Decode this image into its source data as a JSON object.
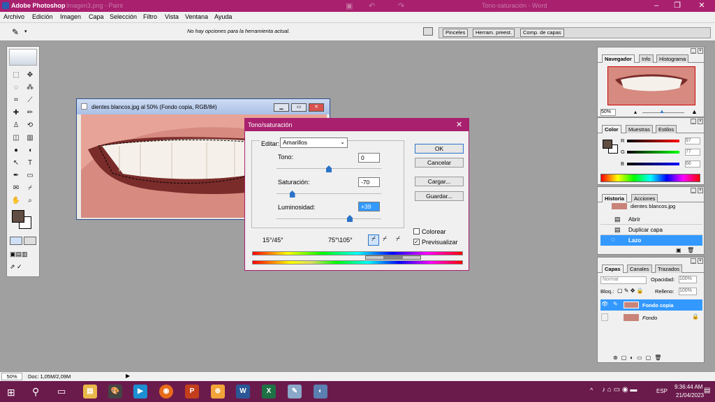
{
  "app": {
    "title": "Adobe Photoshop",
    "ghost_left": "Imagen3.png - Paint",
    "ghost_right": "Tono-saturación - Word"
  },
  "menu": [
    "Archivo",
    "Edición",
    "Imagen",
    "Capa",
    "Selección",
    "Filtro",
    "Vista",
    "Ventana",
    "Ayuda"
  ],
  "options": {
    "hint": "No hay opciones para la herramienta actual.",
    "tabs": [
      "Pinceles",
      "Herram. preest.",
      "Comp. de capas"
    ]
  },
  "document": {
    "title": "dientes blancos.jpg al 50% (Fondo copia, RGB/8#)"
  },
  "dialog": {
    "title": "Tono/saturación",
    "edit_label": "Editar:",
    "edit_value": "Amarillos",
    "tono_label": "Tono:",
    "tono_value": "0",
    "tono_level": 0.5,
    "sat_label": "Saturación:",
    "sat_value": "-70",
    "sat_level": 0.15,
    "lum_label": "Luminosidad:",
    "lum_value": "+39",
    "lum_level": 0.7,
    "range_left": "15°/45°",
    "range_right": "75°\\105°",
    "ok": "OK",
    "cancel": "Cancelar",
    "load": "Cargar...",
    "save": "Guardar...",
    "colorize": "Colorear",
    "preview": "Previsualizar",
    "preview_checked": true
  },
  "navigator": {
    "tabs": [
      "Navegador",
      "Info",
      "Histograma"
    ],
    "zoom": "50%"
  },
  "color": {
    "tabs": [
      "Color",
      "Muestras",
      "Estilos"
    ],
    "r_label": "R",
    "r": "97",
    "g_label": "G",
    "g": "77",
    "b_label": "B",
    "b": "66",
    "swatch": "#614d42"
  },
  "history": {
    "tabs": [
      "Historia",
      "Acciones"
    ],
    "snapshot": "dientes blancos.jpg",
    "items": [
      "Abrir",
      "Duplicar capa",
      "Lazo"
    ]
  },
  "layers": {
    "tabs": [
      "Capas",
      "Canales",
      "Trazados"
    ],
    "mode": "Normal",
    "opacity_label": "Opacidad:",
    "opacity": "100%",
    "lock_label": "Bloq.:",
    "fill_label": "Relleno:",
    "fill": "100%",
    "items": [
      "Fondo copia",
      "Fondo"
    ]
  },
  "status": {
    "zoom": "50%",
    "doc": "Doc: 1,05M/2,09M"
  },
  "taskbar": {
    "lang": "ESP",
    "time": "9:36:44 AM",
    "date": "21/04/2023"
  },
  "colors": {
    "accent": "#a8206e",
    "select": "#3399ff"
  }
}
